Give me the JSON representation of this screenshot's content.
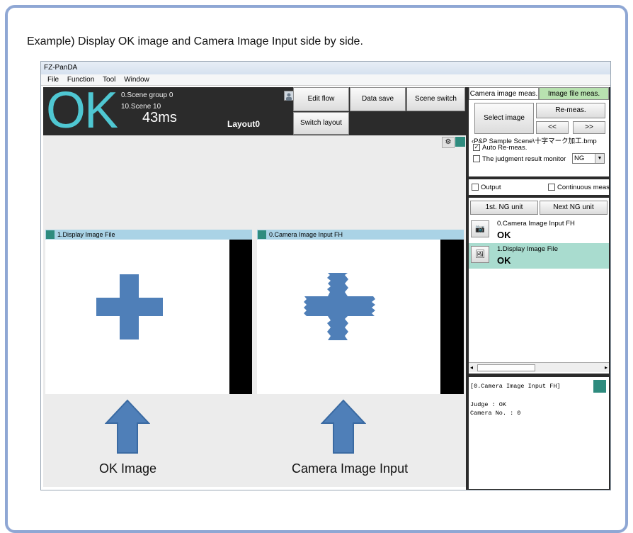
{
  "caption": "Example) Display OK image and Camera Image Input side by side.",
  "app": {
    "title": "FZ-PanDA",
    "menu": [
      "File",
      "Function",
      "Tool",
      "Window"
    ]
  },
  "status": {
    "judgement": "OK",
    "scene_group": "0.Scene group 0",
    "scene": "10.Scene 10",
    "time": "43ms",
    "layout": "Layout0"
  },
  "toolbar": {
    "edit_flow": "Edit flow",
    "data_save": "Data save",
    "scene_switch": "Scene switch",
    "switch_layout": "Switch layout"
  },
  "panels": {
    "left_title": "1.Display Image File",
    "right_title": "0.Camera Image Input FH",
    "left_caption": "OK Image",
    "right_caption": "Camera Image Input"
  },
  "right": {
    "tab_camera": "Camera image meas.",
    "tab_file": "Image file meas.",
    "select_image": "Select image",
    "remeas": "Re-meas.",
    "prev": "<<",
    "next": ">>",
    "file_path": "‹P&P Sample Scene\\十字マーク加工.bmp",
    "auto_remeas": "Auto Re-meas.",
    "judgment_monitor": "The judgment result monitor",
    "ng": "NG",
    "output": "Output",
    "continuous": "Continuous meas",
    "first_ng": "1st. NG unit",
    "next_ng": "Next NG unit",
    "units": [
      {
        "name": "0.Camera Image Input FH",
        "result": "OK"
      },
      {
        "name": "1.Display Image File",
        "result": "OK"
      }
    ],
    "detail_header": "[0.Camera Image Input FH]",
    "detail_judge": "Judge : OK",
    "detail_camera": "Camera No. : 0"
  },
  "colors": {
    "ok_text": "#4fc7d2",
    "accent_teal": "#2e8b7e",
    "arrow_blue": "#4f7fb8",
    "frame_border": "#8fa7d4"
  }
}
